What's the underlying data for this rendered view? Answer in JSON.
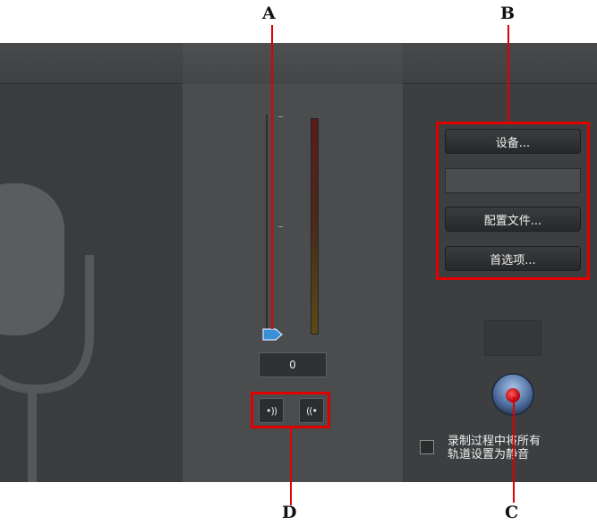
{
  "callouts": {
    "a": "A",
    "b": "B",
    "c": "C",
    "d": "D"
  },
  "input_level": {
    "value": "0",
    "slider_level": 0
  },
  "device_buttons": {
    "devices": "设备...",
    "profiles": "配置文件...",
    "preferences": "首选项..."
  },
  "monitor_buttons": {
    "output_glyph": "•))",
    "input_glyph": "((•"
  },
  "mute_option": {
    "label_line1": "录制过程中将所有",
    "label_line2": "轨道设置为静音"
  },
  "icons": {
    "microphone": "microphone-icon",
    "record": "record-icon",
    "slider_thumb": "slider-thumb-icon"
  },
  "colors": {
    "callout": "#e00000",
    "panel": "#3b3d3f",
    "thumb": "#3a8fd6",
    "record_red": "#e0101a"
  }
}
